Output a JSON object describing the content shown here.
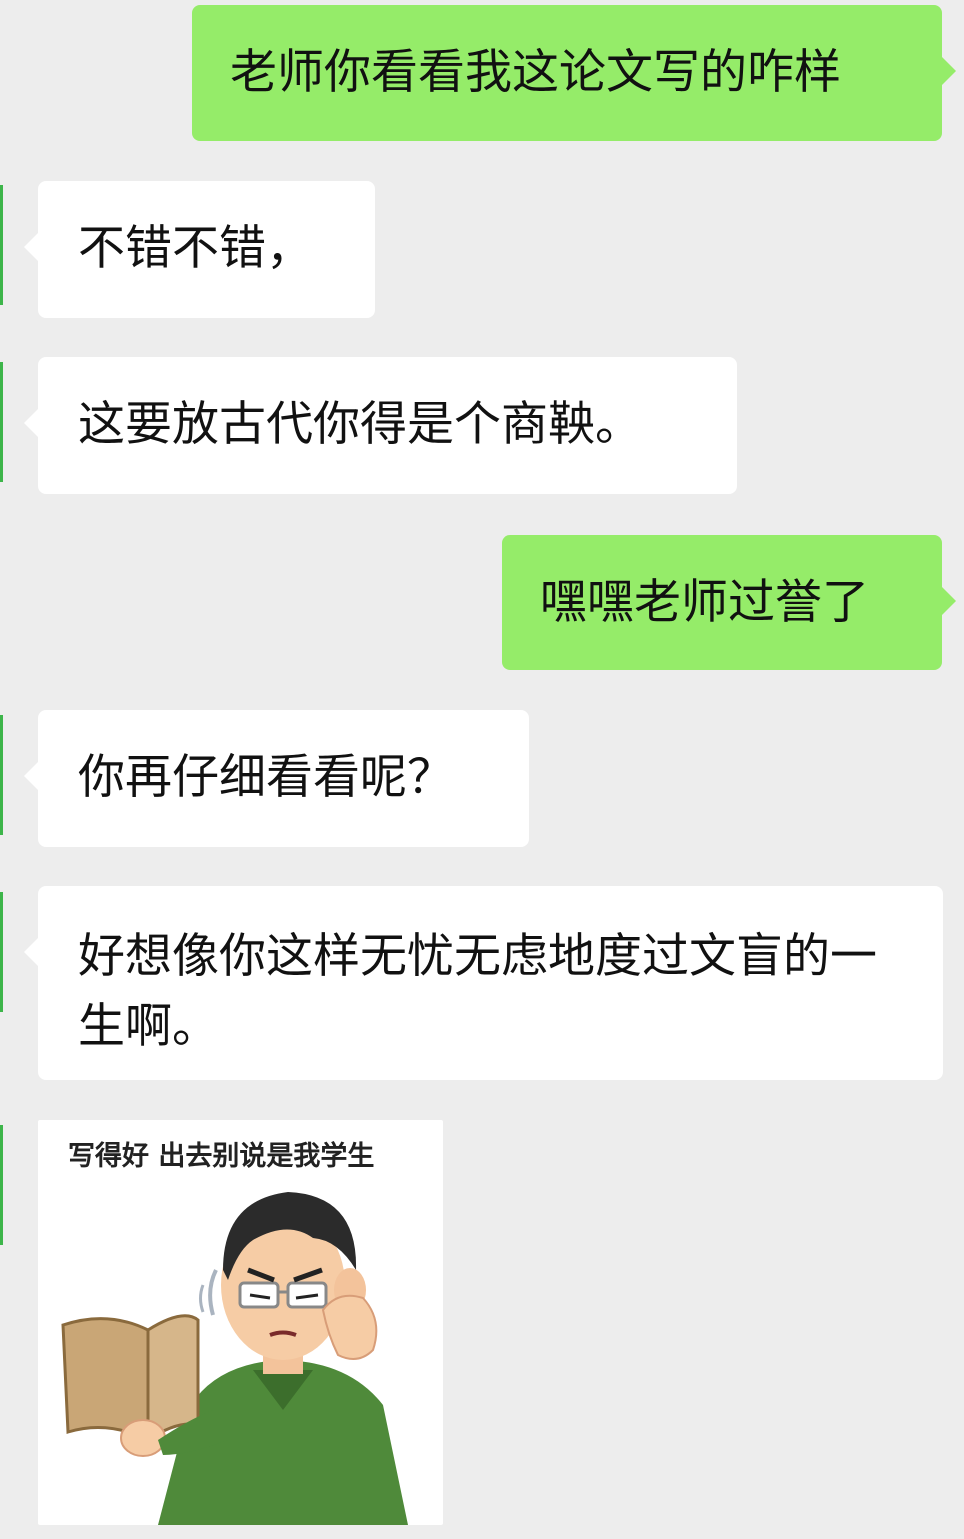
{
  "messages": [
    {
      "side": "right",
      "text": "老师你看看我这论文写的咋样"
    },
    {
      "side": "left",
      "text": "不错不错，"
    },
    {
      "side": "left",
      "text": "这要放古代你得是个商鞅。"
    },
    {
      "side": "right",
      "text": "嘿嘿老师过誉了"
    },
    {
      "side": "left",
      "text": "你再仔细看看呢？"
    },
    {
      "side": "left",
      "text": "好想像你这样无忧无虑地度过文盲的一生啊。"
    }
  ],
  "sticker": {
    "caption": "写得好 出去别说是我学生",
    "icon": "teacher-reading-book-illustration"
  },
  "colors": {
    "background": "#ededed",
    "incoming_bubble": "#ffffff",
    "outgoing_bubble": "#95ec69"
  }
}
